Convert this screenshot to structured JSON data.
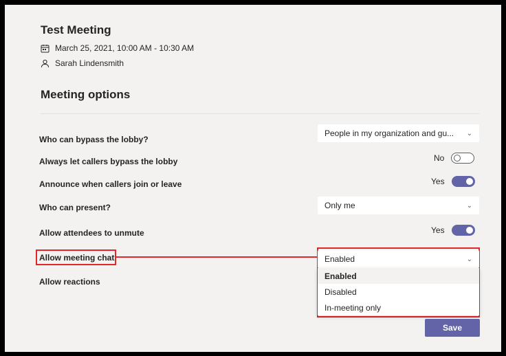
{
  "meeting": {
    "title": "Test Meeting",
    "datetime": "March 25, 2021, 10:00 AM - 10:30 AM",
    "organizer": "Sarah Lindensmith"
  },
  "section_title": "Meeting options",
  "options": {
    "bypass_lobby": {
      "label": "Who can bypass the lobby?",
      "value": "People in my organization and gu..."
    },
    "callers_bypass": {
      "label": "Always let callers bypass the lobby",
      "state": "No",
      "on": false
    },
    "announce": {
      "label": "Announce when callers join or leave",
      "state": "Yes",
      "on": true
    },
    "presenter": {
      "label": "Who can present?",
      "value": "Only me"
    },
    "unmute": {
      "label": "Allow attendees to unmute",
      "state": "Yes",
      "on": true
    },
    "chat": {
      "label": "Allow meeting chat",
      "value": "Enabled"
    },
    "reactions": {
      "label": "Allow reactions"
    }
  },
  "chat_dropdown": {
    "options": [
      "Enabled",
      "Disabled",
      "In-meeting only"
    ],
    "selected": "Enabled"
  },
  "save_label": "Save",
  "colors": {
    "accent": "#6264a7",
    "highlight": "#e3262a",
    "background": "#f3f2f1"
  },
  "icons": {
    "chevron": "chevron-down-icon",
    "calendar": "calendar-icon",
    "person": "person-icon"
  }
}
